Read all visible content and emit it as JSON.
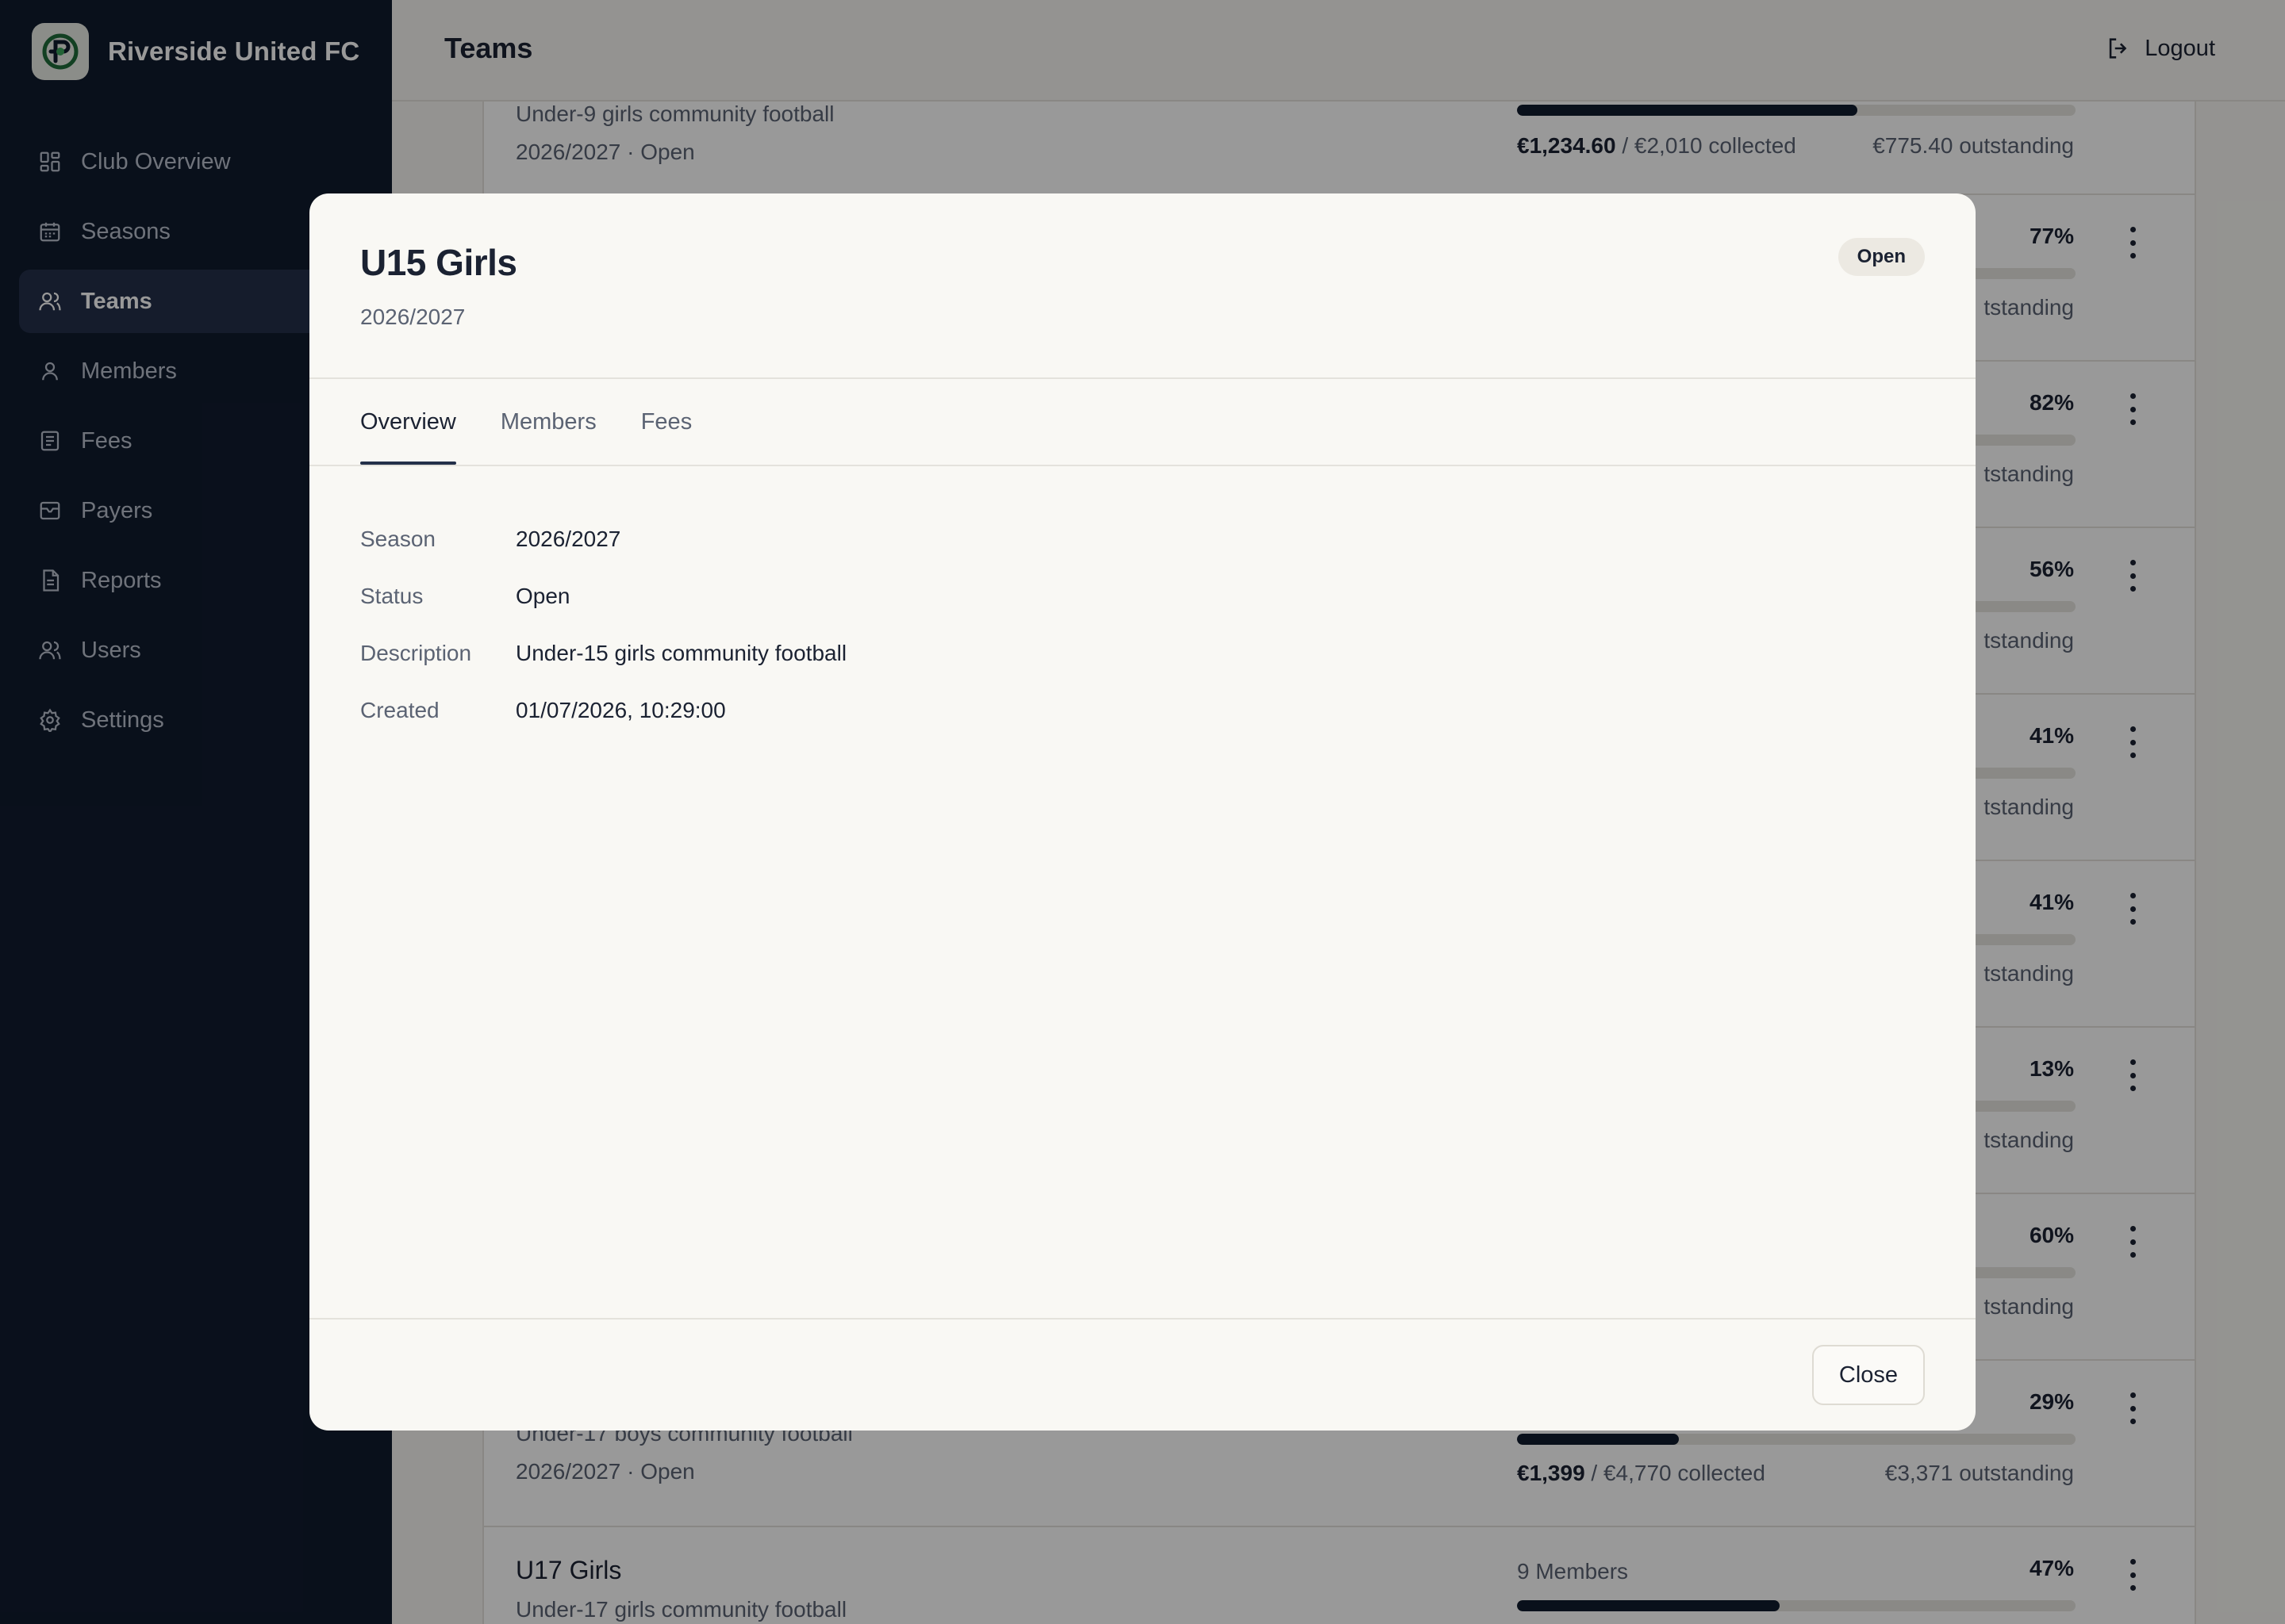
{
  "sidebar": {
    "brand_name": "Riverside United FC",
    "items": [
      {
        "label": "Club Overview",
        "icon": "grid-icon"
      },
      {
        "label": "Seasons",
        "icon": "calendar-icon"
      },
      {
        "label": "Teams",
        "icon": "users-icon",
        "active": true
      },
      {
        "label": "Members",
        "icon": "user-icon"
      },
      {
        "label": "Fees",
        "icon": "receipt-icon"
      },
      {
        "label": "Payers",
        "icon": "wallet-icon"
      },
      {
        "label": "Reports",
        "icon": "document-icon"
      },
      {
        "label": "Users",
        "icon": "users-icon"
      },
      {
        "label": "Settings",
        "icon": "gear-icon"
      }
    ]
  },
  "header": {
    "title": "Teams",
    "logout_label": "Logout"
  },
  "teams": [
    {
      "desc": "Under-9 girls community football",
      "meta": "2026/2027 · Open",
      "progress": 0.61,
      "collected": "€1,234.60",
      "total": " / €2,010 collected",
      "outstanding": "€775.40 outstanding"
    },
    {
      "percent": "77%",
      "outstanding": "tstanding",
      "progress": 0.77
    },
    {
      "percent": "82%",
      "outstanding": "tstanding",
      "progress": 0.82
    },
    {
      "percent": "56%",
      "outstanding": "tstanding",
      "progress": 0.56
    },
    {
      "percent": "41%",
      "outstanding": "tstanding",
      "progress": 0.41
    },
    {
      "percent": "41%",
      "outstanding": "tstanding",
      "progress": 0.41
    },
    {
      "percent": "13%",
      "outstanding": "tstanding",
      "progress": 0.13
    },
    {
      "percent": "60%",
      "outstanding": "tstanding",
      "progress": 0.6
    },
    {
      "desc": "Under-17 boys community football",
      "meta": "2026/2027 · Open",
      "percent": "29%",
      "progress": 0.29,
      "collected": "€1,399",
      "total": " / €4,770 collected",
      "outstanding": "€3,371 outstanding"
    },
    {
      "name": "U17 Girls",
      "desc": "Under-17 girls community football",
      "members": "9 Members",
      "percent": "47%",
      "progress": 0.47
    }
  ],
  "modal": {
    "title": "U15 Girls",
    "subtitle": "2026/2027",
    "status_badge": "Open",
    "tabs": [
      "Overview",
      "Members",
      "Fees"
    ],
    "active_tab": "Overview",
    "details": [
      {
        "label": "Season",
        "value": "2026/2027"
      },
      {
        "label": "Status",
        "value": "Open"
      },
      {
        "label": "Description",
        "value": "Under-15 girls community football"
      },
      {
        "label": "Created",
        "value": "01/07/2026, 10:29:00"
      }
    ],
    "close_label": "Close"
  },
  "colors": {
    "sidebar_bg": "#101b2e",
    "accent": "#23304a",
    "progress_fill": "#101b2e",
    "page_bg": "#f7f6f2"
  }
}
